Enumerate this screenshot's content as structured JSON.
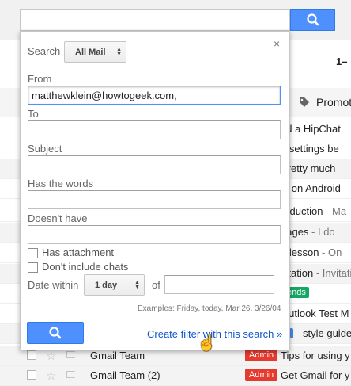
{
  "colors": {
    "accent": "#4d90fe",
    "link": "#1155cc",
    "admin_badge": "#e73a2e",
    "green_badge": "#16a765"
  },
  "header": {
    "page_count": "1–"
  },
  "tabs": {
    "promotions_label": "Promot",
    "promotions_icon": "tag-icon"
  },
  "background_rows": [
    {
      "text": "ed a HipChat",
      "snippet": ""
    },
    {
      "text": "h settings be",
      "snippet": ""
    },
    {
      "text": "",
      "snippet": "Pretty much"
    },
    {
      "text": "ts on Android",
      "snippet": ""
    },
    {
      "text": "roduction",
      "snippet": " - Ma"
    },
    {
      "text": "nages",
      "snippet": " - I do"
    },
    {
      "text": "n lesson",
      "snippet": " - On"
    },
    {
      "text": "vitation",
      "snippet": " - Invitati"
    },
    {
      "badge": "ends",
      "text": "",
      "snippet": ""
    },
    {
      "text": "Outlook Test M",
      "snippet": ""
    },
    {
      "badge_blue": true,
      "text": "style guide",
      "snippet": ""
    },
    {
      "sender": "Gmail Team",
      "admin": "Admin",
      "text": "Tips for using y",
      "snippet": ""
    },
    {
      "sender": "Gmail Team (2)",
      "admin": "Admin",
      "text": "Get Gmail for y",
      "snippet": ""
    }
  ],
  "search_panel": {
    "search_in_label": "Search",
    "search_in_value": "All Mail",
    "from_label": "From",
    "from_value": "matthewklein@howtogeek.com,",
    "to_label": "To",
    "to_value": "",
    "subject_label": "Subject",
    "subject_value": "",
    "has_words_label": "Has the words",
    "has_words_value": "",
    "doesnt_have_label": "Doesn't have",
    "doesnt_have_value": "",
    "has_attachment_label": "Has attachment",
    "has_attachment_checked": false,
    "dont_include_chats_label": "Don't include chats",
    "dont_include_chats_checked": false,
    "date_within_label": "Date within",
    "date_within_value": "1 day",
    "of_label": "of",
    "of_value": "",
    "examples": "Examples: Friday, today, Mar 26, 3/26/04",
    "create_filter_label": "Create filter with this search »",
    "close_label": "×"
  }
}
